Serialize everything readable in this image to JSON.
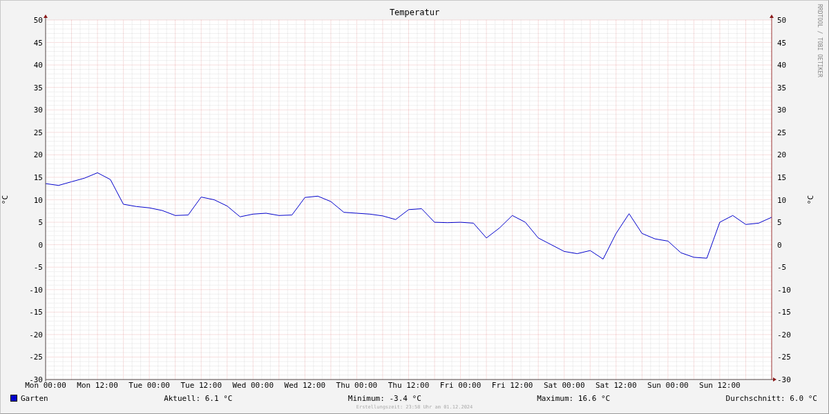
{
  "graph": {
    "title": "Temperatur",
    "watermark": "RRDTOOL / TOBI OETIKER",
    "right_axis_label": "°C",
    "right_yticks": [
      "50",
      "45",
      "40",
      "35",
      "30",
      "25",
      "20",
      "15",
      "10",
      "5",
      "0",
      "-5",
      "-10",
      "-15",
      "-20",
      "-25",
      "-30"
    ],
    "chart_data": {
      "type": "line",
      "ylabel": "°C",
      "grid": true,
      "ylim": [
        -30,
        50
      ],
      "yticks": [
        50,
        45,
        40,
        35,
        30,
        25,
        20,
        15,
        10,
        5,
        0,
        -5,
        -10,
        -15,
        -20,
        -25,
        -30
      ],
      "categories": [
        "Mon 00:00",
        null,
        null,
        null,
        "Mon 12:00",
        null,
        null,
        null,
        "Tue 00:00",
        null,
        null,
        null,
        "Tue 12:00",
        null,
        null,
        null,
        "Wed 00:00",
        null,
        null,
        null,
        "Wed 12:00",
        null,
        null,
        null,
        "Thu 00:00",
        null,
        null,
        null,
        "Thu 12:00",
        null,
        null,
        null,
        "Fri 00:00",
        null,
        null,
        null,
        "Fri 12:00",
        null,
        null,
        null,
        "Sat 00:00",
        null,
        null,
        null,
        "Sat 12:00",
        null,
        null,
        null,
        "Sun 00:00",
        null,
        null,
        null,
        "Sun 12:00",
        null,
        null,
        null,
        null
      ],
      "series": [
        {
          "name": "Garten",
          "color": "#0000cc",
          "values": [
            13.6,
            13.2,
            14.0,
            14.8,
            16.0,
            14.5,
            9.0,
            8.5,
            8.2,
            7.6,
            6.5,
            6.6,
            10.6,
            10.0,
            8.6,
            6.2,
            6.8,
            7.0,
            6.5,
            6.6,
            10.5,
            10.8,
            9.6,
            7.2,
            7.0,
            6.8,
            6.4,
            5.6,
            7.8,
            8.0,
            5.0,
            4.9,
            5.0,
            4.8,
            1.5,
            3.7,
            6.5,
            5.0,
            1.5,
            0.0,
            -1.5,
            -2.0,
            -1.3,
            -3.2,
            2.5,
            6.9,
            2.5,
            1.3,
            0.8,
            -1.8,
            -2.8,
            -3.0,
            5.0,
            6.5,
            4.5,
            4.8,
            6.1
          ]
        }
      ]
    }
  },
  "legend": {
    "stats": [
      "Aktuell: 6.1 °C",
      "Minimum: -3.4 °C",
      "Maximum: 16.6 °C",
      "Durchschnitt: 6.0 °C"
    ]
  },
  "footer": "Erstellungszeit: 23:58 Uhr am 01.12.2024"
}
